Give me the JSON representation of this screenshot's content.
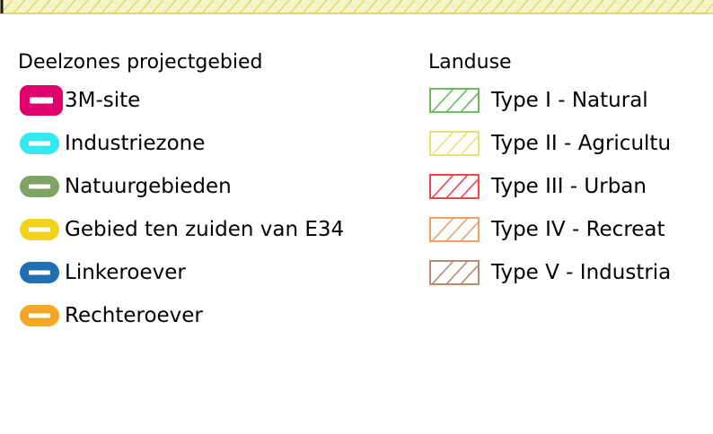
{
  "deelzones": {
    "heading": "Deelzones projectgebied",
    "items": [
      {
        "label": "3M-site",
        "color": "#e0006e",
        "icon": "pill-swatch-large"
      },
      {
        "label": "Industriezone",
        "color": "#33e8ef",
        "icon": "pill-swatch"
      },
      {
        "label": "Natuurgebieden",
        "color": "#7ea362",
        "icon": "pill-swatch"
      },
      {
        "label": "Gebied ten zuiden van E34",
        "color": "#f2d21a",
        "icon": "pill-swatch"
      },
      {
        "label": "Linkeroever",
        "color": "#2170b3",
        "icon": "pill-swatch"
      },
      {
        "label": "Rechteroever",
        "color": "#f5a623",
        "icon": "pill-swatch"
      }
    ]
  },
  "landuse": {
    "heading": "Landuse",
    "items": [
      {
        "label": "Type I - Natural",
        "color": "#6ab85a",
        "icon": "hatched-swatch"
      },
      {
        "label": "Type II - Agricultu",
        "color": "#e8e070",
        "icon": "hatched-swatch"
      },
      {
        "label": "Type III - Urban",
        "color": "#e84848",
        "icon": "hatched-swatch"
      },
      {
        "label": "Type IV - Recreat",
        "color": "#f0a060",
        "icon": "hatched-swatch"
      },
      {
        "label": "Type V - Industria",
        "color": "#b88a70",
        "icon": "hatched-swatch"
      }
    ]
  },
  "top_strip": {
    "color": "#e8e070"
  }
}
